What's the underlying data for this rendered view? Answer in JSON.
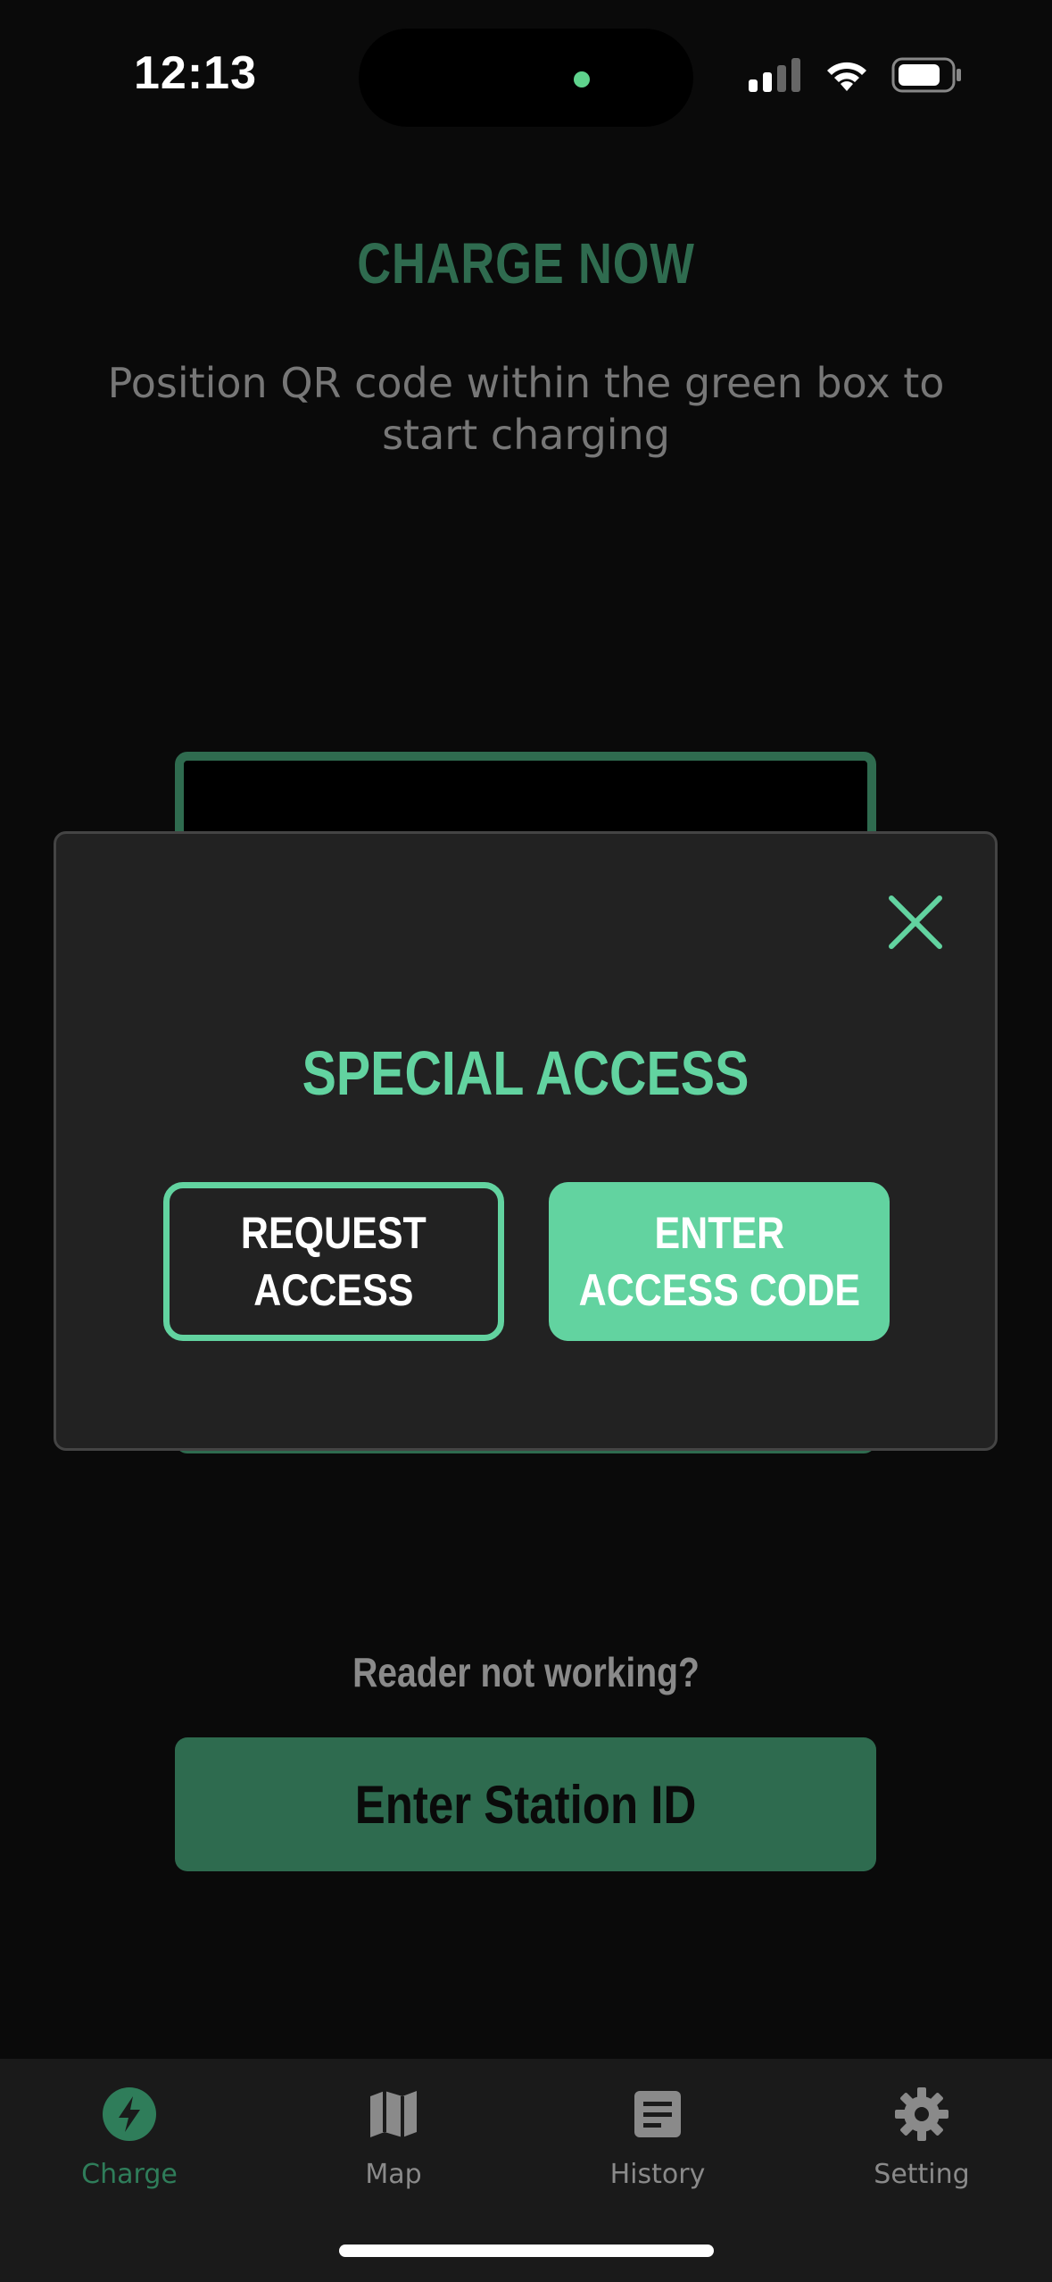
{
  "status_bar": {
    "time": "12:13"
  },
  "page": {
    "title": "CHARGE NOW",
    "subtitle": "Position QR code within the green box to start charging"
  },
  "modal": {
    "title": "SPECIAL ACCESS",
    "request_button": "REQUEST\nACCESS",
    "enter_code_button": "ENTER\nACCESS CODE",
    "close_icon": "close-icon"
  },
  "reader": {
    "question": "Reader not working?",
    "station_button": "Enter Station ID"
  },
  "tabs": [
    {
      "label": "Charge",
      "icon": "lightning-icon",
      "active": true
    },
    {
      "label": "Map",
      "icon": "map-icon",
      "active": false
    },
    {
      "label": "History",
      "icon": "document-icon",
      "active": false
    },
    {
      "label": "Setting",
      "icon": "gear-icon",
      "active": false
    }
  ],
  "colors": {
    "accent": "#62d3a0",
    "dark_green": "#2f6b4f",
    "background": "#0a0a0a",
    "modal_bg": "#222222"
  }
}
